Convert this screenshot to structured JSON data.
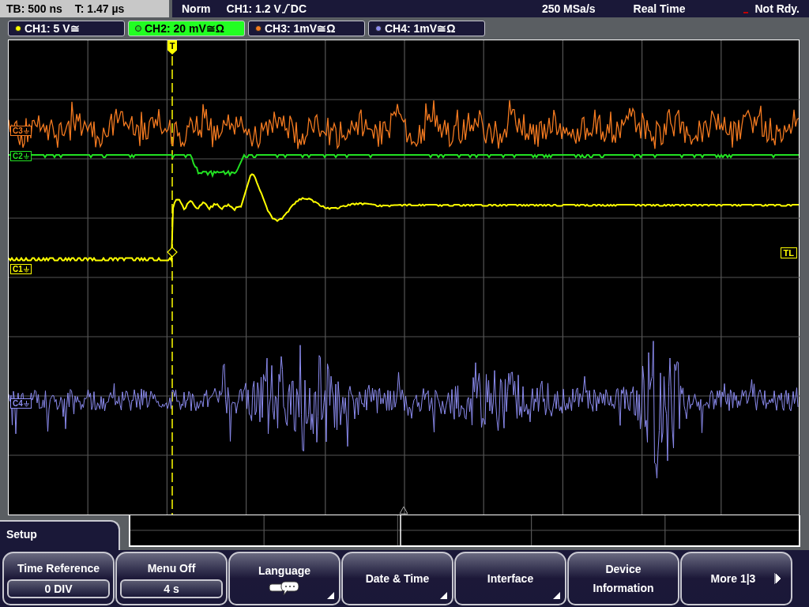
{
  "timebase": {
    "tb": "TB: 500 ns",
    "t": "T: 1.47 µs"
  },
  "status": {
    "mode": "Norm",
    "trigger": "CH1: 1.2 V",
    "coupling": "DC",
    "sample_rate": "250 MSa/s",
    "acquisition": "Real Time",
    "state": "Not Rdy."
  },
  "channels": [
    {
      "label": "CH1: 5 V≅",
      "color": "#ffff00",
      "selected": false
    },
    {
      "label": "CH2: 20 mV≅Ω",
      "color": "#22e022",
      "selected": true
    },
    {
      "label": "CH3: 1mV≅Ω",
      "color": "#f47a20",
      "selected": false
    },
    {
      "label": "CH4: 1mV≅Ω",
      "color": "#8c8cf0",
      "selected": false
    }
  ],
  "display": {
    "trigger_label": "T",
    "level_label": "TL",
    "markers": [
      {
        "label": "C3",
        "color": "#f47a20"
      },
      {
        "label": "C2",
        "color": "#22e022"
      },
      {
        "label": "C1",
        "color": "#ffff00"
      },
      {
        "label": "C4",
        "color": "#8c8cf0"
      }
    ]
  },
  "menu": {
    "title": "Setup",
    "softkeys": [
      {
        "kind": "value",
        "label": "Time Reference",
        "value": "0 DIV"
      },
      {
        "kind": "value",
        "label": "Menu Off",
        "value": "4 s"
      },
      {
        "kind": "icon",
        "label": "Language",
        "submenu": true
      },
      {
        "kind": "plain",
        "label": "Date & Time",
        "submenu": true
      },
      {
        "kind": "plain",
        "label": "Interface",
        "submenu": true
      },
      {
        "kind": "plain",
        "label": "Device Information",
        "submenu": false
      },
      {
        "kind": "next",
        "label": "More 1|3"
      }
    ]
  }
}
